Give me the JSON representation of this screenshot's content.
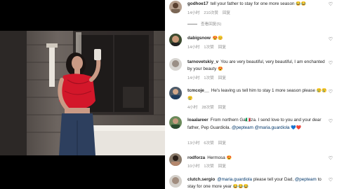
{
  "comments": [
    {
      "user": "godhoe17",
      "text": "tell your father to stay for one more season",
      "emoji": "😂😂",
      "time": "14小时",
      "likes": "210次赞",
      "reply": "回复",
      "replies_link": "查看回复(5)"
    },
    {
      "user": "dabigsnow",
      "text": "",
      "emoji": "😍😊",
      "time": "14小时",
      "likes": "1次赞",
      "reply": "回复"
    },
    {
      "user": "tarnovetskiy_v",
      "text": "You are very beautiful, very beautiful, I am enchanted by your beauty",
      "emoji": "😍",
      "time": "14小时",
      "likes": "1次赞",
      "reply": "回复"
    },
    {
      "user": "tcmcoje__",
      "text": "He's leaving us tell him to stay 1 more season please",
      "emoji": "😢😢😢",
      "time": "4小时",
      "likes": "28次赞",
      "reply": "回复"
    },
    {
      "user": "loaalareer",
      "text_a": "From northern Ga",
      "flag": "🇮🇹",
      "text_b": "za. I send love to you and your dear father, Pep Guardiola.",
      "mention1": "@pepteam",
      "mention2": "@maria.guardiola",
      "end_emoji": "💙❤️",
      "time": "13小时",
      "likes": "6次赞",
      "reply": "回复"
    },
    {
      "user": "rodforza",
      "text": "Hermosa",
      "emoji": "😍",
      "time": "10小时",
      "likes": "1次赞",
      "reply": "回复"
    },
    {
      "user": "clutch.sergio",
      "mention1": "@maria.guardiola",
      "text_a": "please tell your Dad,",
      "mention2": "@pepteam",
      "text_b": "to stay for one more year",
      "emoji": "😂😂😂"
    }
  ]
}
